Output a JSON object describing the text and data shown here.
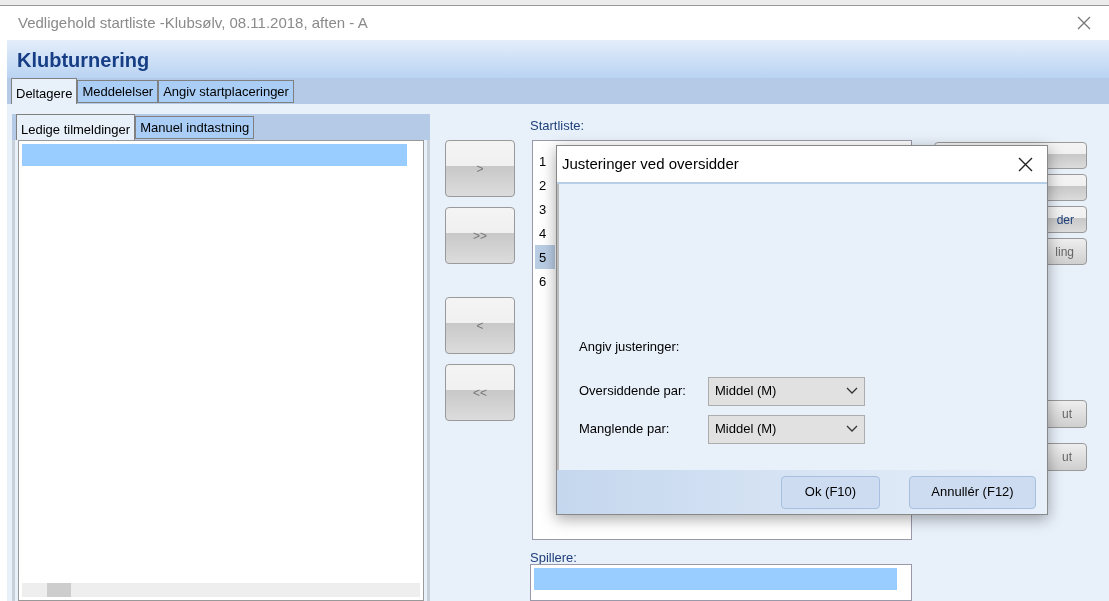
{
  "window": {
    "title": "Vedligehold startliste -Klubsølv, 08.11.2018, aften - A"
  },
  "header": "Klubturnering",
  "tabs": [
    {
      "label": "Deltagere",
      "selected": true
    },
    {
      "label": "Meddelelser",
      "selected": false
    },
    {
      "label": "Angiv startplaceringer",
      "selected": false
    }
  ],
  "subtabs": [
    {
      "label": "Ledige tilmeldinger",
      "selected": true
    },
    {
      "label": "Manuel indtastning",
      "selected": false
    }
  ],
  "available_rows": [
    {
      "selected": true
    }
  ],
  "move_buttons": [
    {
      "label": ">"
    },
    {
      "label": ">>"
    },
    {
      "label": "<"
    },
    {
      "label": "<<"
    }
  ],
  "startlist": {
    "label": "Startliste:",
    "rows": [
      {
        "number": "1",
        "selected": false
      },
      {
        "number": "2",
        "selected": false
      },
      {
        "number": "3",
        "selected": false
      },
      {
        "number": "4",
        "selected": false
      },
      {
        "number": "5",
        "selected": true
      },
      {
        "number": "6",
        "selected": false
      }
    ]
  },
  "players": {
    "label": "Spillere:",
    "rows": [
      {
        "selected": true
      }
    ]
  },
  "right_buttons_top": [
    {
      "disabled": false
    },
    {
      "disabled": false
    },
    {
      "label": "der",
      "disabled": false
    },
    {
      "label": "ling",
      "disabled": true
    }
  ],
  "right_buttons_bottom": [
    {
      "label": "ut",
      "disabled": true
    },
    {
      "label": "ut",
      "disabled": true
    }
  ],
  "dialog": {
    "title": "Justeringer ved oversidder",
    "prompt": "Angiv justeringer:",
    "fields": [
      {
        "label": "Oversiddende par:",
        "value": "Middel (M)"
      },
      {
        "label": "Manglende par:",
        "value": "Middel (M)"
      }
    ],
    "buttons": [
      "Ok (F10)",
      "Annullér (F12)"
    ]
  }
}
